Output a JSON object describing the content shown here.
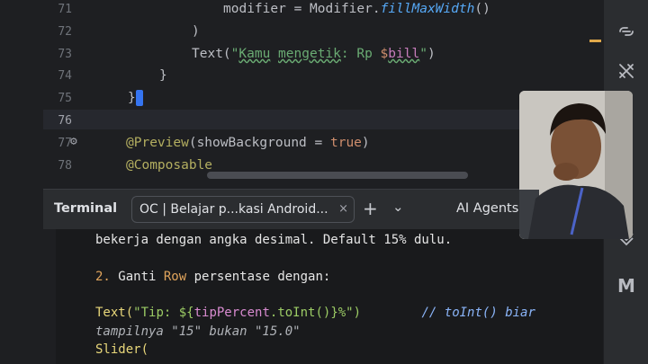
{
  "editor": {
    "lines": [
      {
        "num": "71",
        "parts": [
          {
            "t": "modifier = Modifier.",
            "c": "ident"
          },
          {
            "t": "fillMaxWidth",
            "c": "fn-ital"
          },
          {
            "t": "()",
            "c": "ident"
          }
        ]
      },
      {
        "num": "72",
        "parts": [
          {
            "t": ")",
            "c": "ident"
          }
        ]
      },
      {
        "num": "73",
        "parts": [
          {
            "t": "Text(",
            "c": "ident"
          },
          {
            "t": "\"",
            "c": "str"
          },
          {
            "t": "Kamu",
            "c": "squig str"
          },
          {
            "t": " ",
            "c": "str"
          },
          {
            "t": "mengetik",
            "c": "squig str"
          },
          {
            "t": ": Rp ",
            "c": "str"
          },
          {
            "t": "$",
            "c": "kw"
          },
          {
            "t": "bill",
            "c": "var"
          },
          {
            "t": "\"",
            "c": "str"
          },
          {
            "t": ")",
            "c": "ident"
          }
        ]
      },
      {
        "num": "74",
        "parts": [
          {
            "t": "}",
            "c": "ident"
          }
        ]
      },
      {
        "num": "75",
        "parts": [
          {
            "t": "}",
            "c": "ident"
          }
        ]
      },
      {
        "num": "76",
        "parts": []
      },
      {
        "num": "77",
        "parts": [
          {
            "t": "@Preview",
            "c": "ann"
          },
          {
            "t": "(showBackground = ",
            "c": "ident"
          },
          {
            "t": "true",
            "c": "kw"
          },
          {
            "t": ")",
            "c": "ident"
          }
        ]
      },
      {
        "num": "78",
        "parts": [
          {
            "t": "@Composable",
            "c": "ann"
          }
        ]
      }
    ]
  },
  "terminal": {
    "title": "Terminal",
    "tab_label": "OC | Belajar p...kasi Android...",
    "tab_close": "×",
    "add": "+",
    "more": "⌄",
    "ai_agents": "AI Agents",
    "lines": [
      [
        {
          "t": "bekerja dengan angka desimal. Default 15% dulu.",
          "c": ""
        }
      ],
      [],
      [
        {
          "t": "2. ",
          "c": "t-orange"
        },
        {
          "t": "Ganti ",
          "c": ""
        },
        {
          "t": "Row",
          "c": "t-orange"
        },
        {
          "t": " persentase dengan:",
          "c": ""
        }
      ],
      [],
      [
        {
          "t": "Text(",
          "c": "t-yellow"
        },
        {
          "t": "\"Tip: ${",
          "c": "t-green"
        },
        {
          "t": "tipPercent",
          "c": "t-pink"
        },
        {
          "t": ".toInt()}%\")",
          "c": "t-green"
        },
        {
          "t": "        // toInt() biar",
          "c": "t-cmt"
        }
      ],
      [
        {
          "t": "tampilnya \"15\" bukan \"15.0\"",
          "c": "t-dim"
        }
      ],
      [
        {
          "t": "Slider(",
          "c": "t-yellow"
        }
      ]
    ]
  },
  "toolstrip": {
    "icons": [
      "link-icon",
      "build-tools-icon",
      "device-icon",
      "gradle-m-icon"
    ],
    "gradle_letter": "M"
  },
  "colors": {
    "editor_bg": "#1e1f22",
    "panel_bg": "#2b2d30",
    "terminal_bg": "#191a1c",
    "caret_accent": "#3574f0"
  }
}
